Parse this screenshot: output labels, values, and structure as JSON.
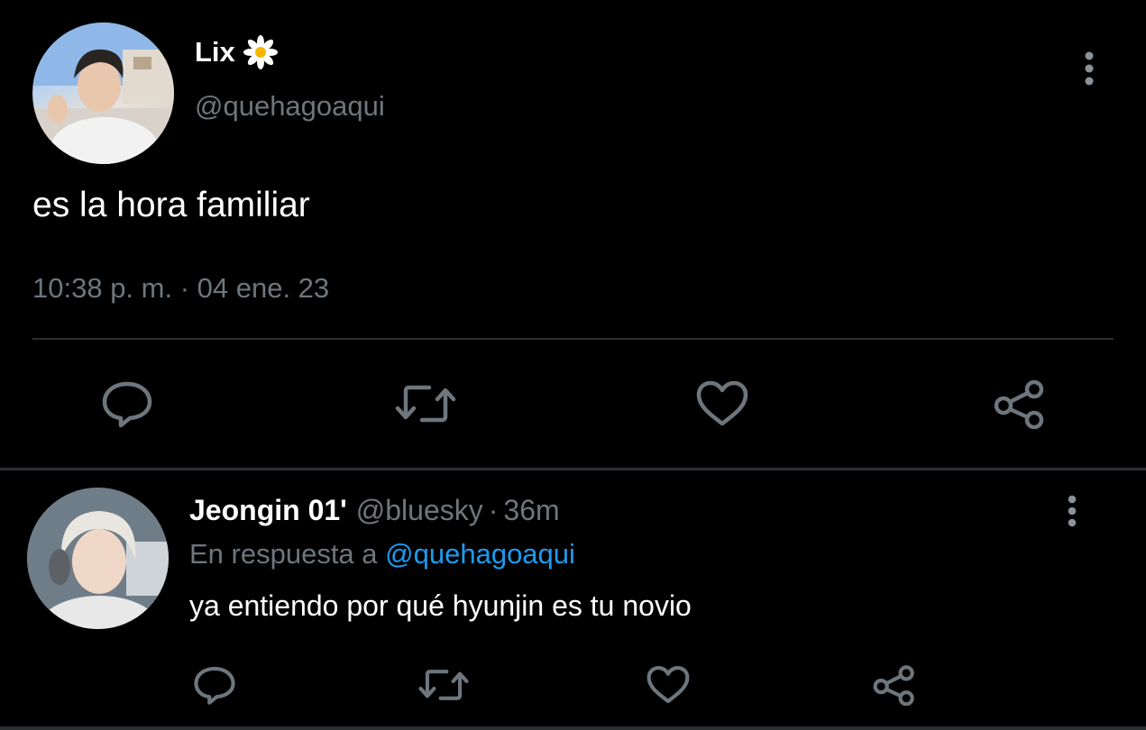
{
  "main_tweet": {
    "display_name": "Lix",
    "name_icon": "daisy-flower-icon",
    "handle": "@quehagoaqui",
    "text": "es la hora familiar",
    "timestamp": "10:38 p. m. · 04 ene. 23",
    "actions": [
      "reply-icon",
      "retweet-icon",
      "like-icon",
      "share-icon"
    ],
    "more_icon": "more-vertical-icon"
  },
  "reply": {
    "display_name": "Jeongin 01'",
    "handle": "@bluesky",
    "separator": "·",
    "time": "36m",
    "in_reply_to_label": "En respuesta a",
    "in_reply_to_handle": "@quehagoaqui",
    "text": "ya entiendo por qué hyunjin es tu novio",
    "actions": [
      "reply-icon",
      "retweet-icon",
      "like-icon",
      "share-icon"
    ],
    "more_icon": "more-vertical-icon"
  },
  "colors": {
    "background": "#000000",
    "primary_text": "#ffffff",
    "secondary_text": "#6e767d",
    "icon": "#6e767d",
    "divider": "#2b2f33",
    "link": "#1d9bf0"
  }
}
